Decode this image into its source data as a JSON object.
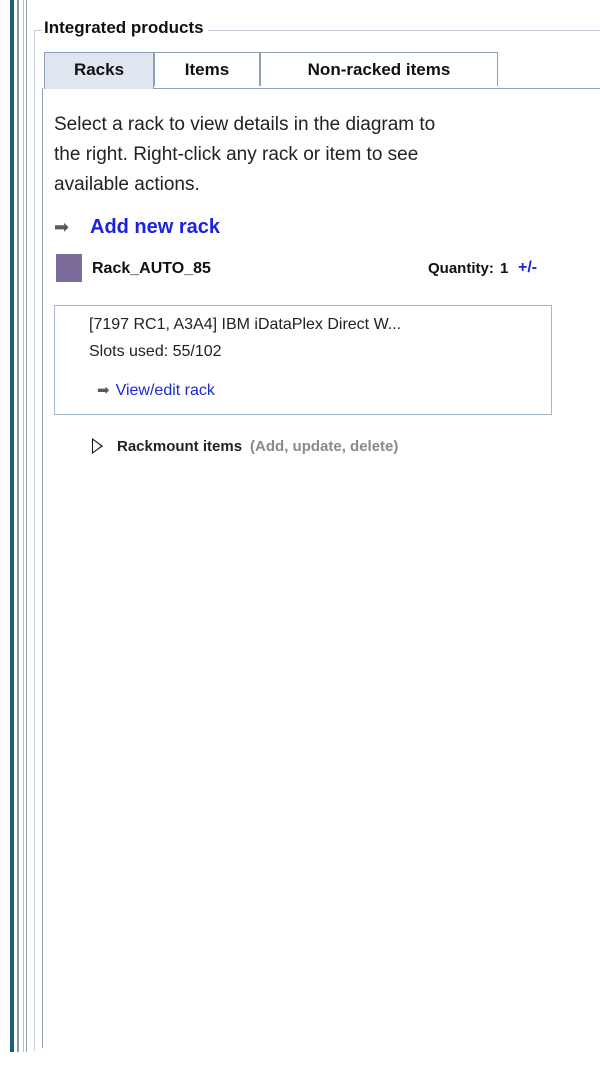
{
  "group": {
    "title": "Integrated products"
  },
  "tabs": [
    {
      "label": "Racks",
      "selected": true
    },
    {
      "label": "Items",
      "selected": false
    },
    {
      "label": "Non-racked items",
      "selected": false
    }
  ],
  "instructions": {
    "line1": "Select a rack to view details in the diagram to",
    "line2": "the right. Right-click any rack or item to see",
    "line3": " available actions."
  },
  "add_rack": {
    "label": "Add new rack",
    "icon": "arrow-right-icon"
  },
  "rack": {
    "name": "Rack_AUTO_85",
    "swatch_color": "#7a6b9a",
    "quantity_label": "Quantity:",
    "quantity_value": "1",
    "quantity_toggle": "+/-",
    "description": "[7197 RC1, A3A4] IBM iDataPlex Direct W...",
    "slots_used": "Slots used: 55/102",
    "view_edit_label": "View/edit rack"
  },
  "rackmount": {
    "label": "Rackmount items",
    "hint": "(Add, update, delete)"
  },
  "colors": {
    "link": "#1a22e0",
    "tab_border": "#8fa0b8",
    "selected_tab_bg": "#dfe6ef"
  }
}
